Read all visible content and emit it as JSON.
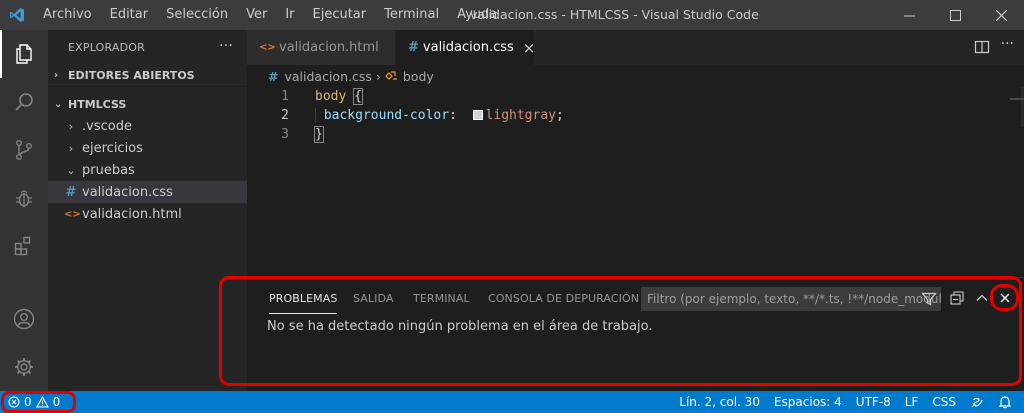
{
  "window": {
    "title": "validacion.css - HTMLCSS - Visual Studio Code",
    "menu": [
      "Archivo",
      "Editar",
      "Selección",
      "Ver",
      "Ir",
      "Ejecutar",
      "Terminal",
      "Ayuda"
    ]
  },
  "sidebar": {
    "header": "EXPLORADOR",
    "more": "···",
    "open_editors": "EDITORES ABIERTOS",
    "folder": "HTMLCSS",
    "items": [
      {
        "label": ".vscode",
        "chevron": "›"
      },
      {
        "label": "ejercicios",
        "chevron": "›"
      },
      {
        "label": "pruebas",
        "chevron": "⌄"
      },
      {
        "label": "validacion.css",
        "glyph": "#"
      },
      {
        "label": "validacion.html",
        "glyph": "<>"
      }
    ]
  },
  "tabs": [
    {
      "label": "validacion.html",
      "active": false,
      "glyph": "<>"
    },
    {
      "label": "validacion.css",
      "active": true,
      "glyph": "#",
      "close": "×"
    }
  ],
  "breadcrumb": {
    "file": "validacion.css",
    "glyph": "#",
    "separator": "›",
    "symbol": "body"
  },
  "editor": {
    "line_numbers": [
      "1",
      "2",
      "3"
    ],
    "lines": {
      "l1_selector": "body",
      "l1_brace": "{",
      "l2_prop": "background-color",
      "l2_colon": ":",
      "l2_value": "lightgray",
      "l2_semicolon": ";",
      "l3_brace": "}"
    },
    "swatch_color": "#d3d3d3"
  },
  "panel": {
    "tabs": [
      "PROBLEMAS",
      "SALIDA",
      "TERMINAL",
      "CONSOLA DE DEPURACIÓN"
    ],
    "active_tab": "PROBLEMAS",
    "filter_placeholder": "Filtro (por ejemplo, texto, **/*.ts, !**/node_modul...",
    "message": "No se ha detectado ningún problema en el área de trabajo."
  },
  "statusbar": {
    "errors": "0",
    "warnings": "0",
    "position": "Lín. 2, col. 30",
    "spaces": "Espacios: 4",
    "encoding": "UTF-8",
    "eol": "LF",
    "language": "CSS"
  },
  "colors": {
    "accent": "#007acc",
    "highlight": "#e50000"
  }
}
